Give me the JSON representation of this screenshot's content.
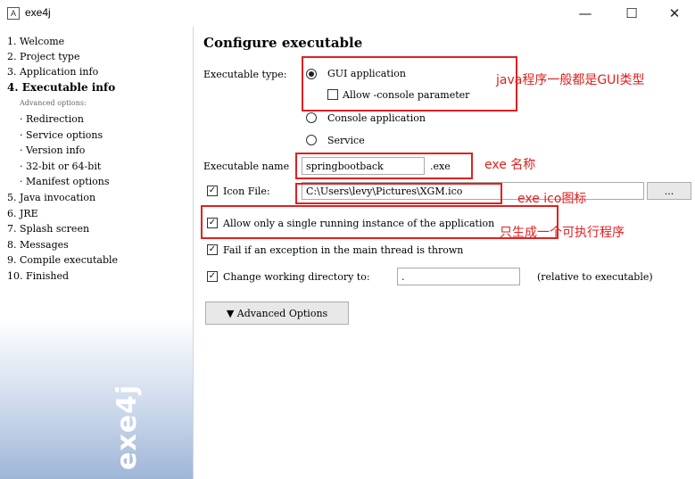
{
  "window": {
    "icon_letter": "A",
    "title": "exe4j",
    "minimize": "—",
    "maximize": "☐",
    "close": "✕"
  },
  "sidebar": {
    "steps": [
      "1. Welcome",
      "2. Project type",
      "3. Application info",
      "4. Executable info",
      "5. Java invocation",
      "6. JRE",
      "7. Splash screen",
      "8. Messages",
      "9. Compile executable",
      "10. Finished"
    ],
    "advanced_label": "Advanced options:",
    "sub_items": [
      "· Redirection",
      "· Service options",
      "· Version info",
      "· 32-bit or 64-bit",
      "· Manifest options"
    ],
    "banner_logo": "exe4j"
  },
  "main": {
    "heading": "Configure executable",
    "executable_type_label": "Executable type:",
    "radio_gui": "GUI application",
    "allow_console": "Allow -console parameter",
    "radio_console": "Console application",
    "radio_service": "Service",
    "executable_name_label": "Executable name",
    "executable_name_value": "springbootback",
    "exe_suffix": ".exe",
    "icon_file_label": "Icon File:",
    "icon_file_value": "C:\\Users\\levy\\Pictures\\XGM.ico",
    "browse_label": "...",
    "single_instance": "Allow only a single running instance of the application",
    "fail_exception": "Fail if an exception in the main thread is thrown",
    "change_dir_label": "Change working directory to:",
    "change_dir_value": ".",
    "relative_note": "(relative to executable)",
    "advanced_options_button": "▼ Advanced Options",
    "checked_mark": "✓"
  },
  "annotations": {
    "gui_note": "java程序一般都是GUI类型",
    "name_note": "exe 名称",
    "icon_note": "exe ico图标",
    "single_note": "只生成一个可执行程序",
    "color": "#e02020"
  }
}
